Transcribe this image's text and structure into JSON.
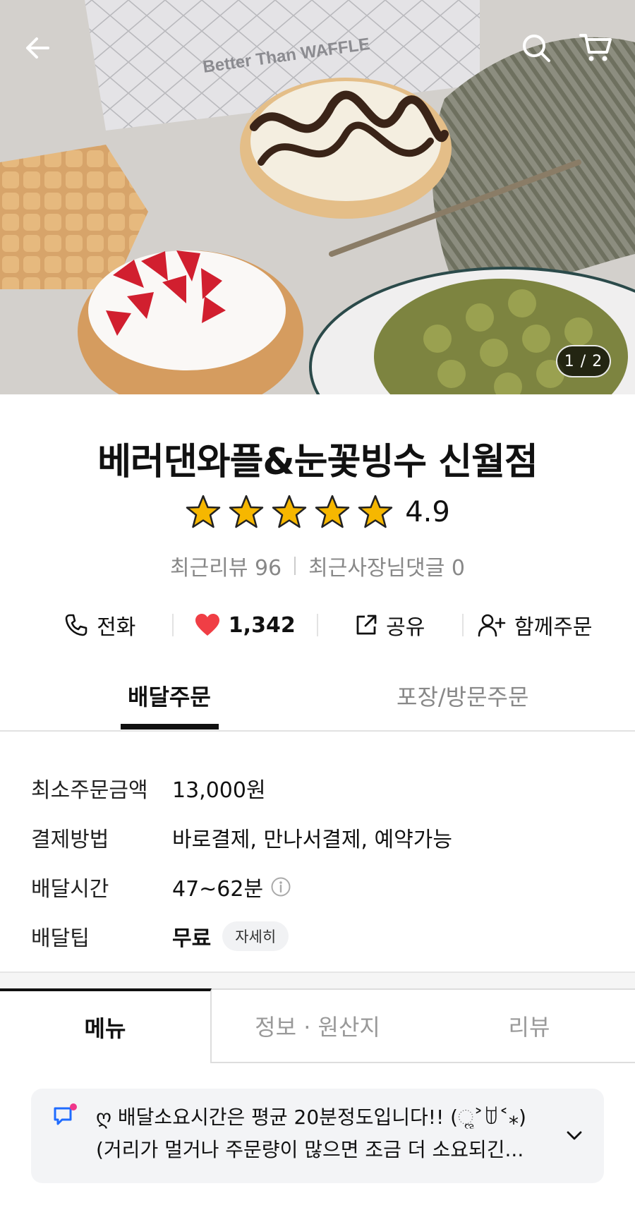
{
  "header": {
    "back_icon": "arrow-left-icon",
    "search_icon": "search-icon",
    "cart_icon": "cart-icon",
    "box_text": "Better Than WAFFLE",
    "image_counter": "1 / 2"
  },
  "store": {
    "name": "베러댄와플&눈꽃빙수 신월점",
    "rating": "4.9",
    "stars": 5,
    "recent_reviews": "최근리뷰 96",
    "owner_replies": "최근사장님댓글 0"
  },
  "actions": {
    "call": "전화",
    "likes": "1,342",
    "share": "공유",
    "group_order": "함께주문"
  },
  "order_tabs": {
    "delivery": "배달주문",
    "pickup": "포장/방문주문"
  },
  "info": {
    "min_order_label": "최소주문금액",
    "min_order_value": "13,000원",
    "payment_label": "결제방법",
    "payment_value": "바로결제, 만나서결제, 예약가능",
    "delivery_time_label": "배달시간",
    "delivery_time_value": "47~62분",
    "delivery_tip_label": "배달팁",
    "delivery_tip_value": "무료",
    "detail_button": "자세히"
  },
  "menu_tabs": {
    "menu": "메뉴",
    "info_origin": "정보 · 원산지",
    "review": "리뷰"
  },
  "notice": {
    "line1": "ღ 배달소요시간은 평균 20분정도입니다!! (ૢ˃ꌂ˂⁎)",
    "line2": "(거리가 멀거나 주문량이 많으면 조금 더 소요되긴..."
  },
  "colors": {
    "heart": "#f03e45",
    "star": "#f6b700",
    "notice_icon": "#1f6bff",
    "notice_dot": "#f0368a"
  }
}
